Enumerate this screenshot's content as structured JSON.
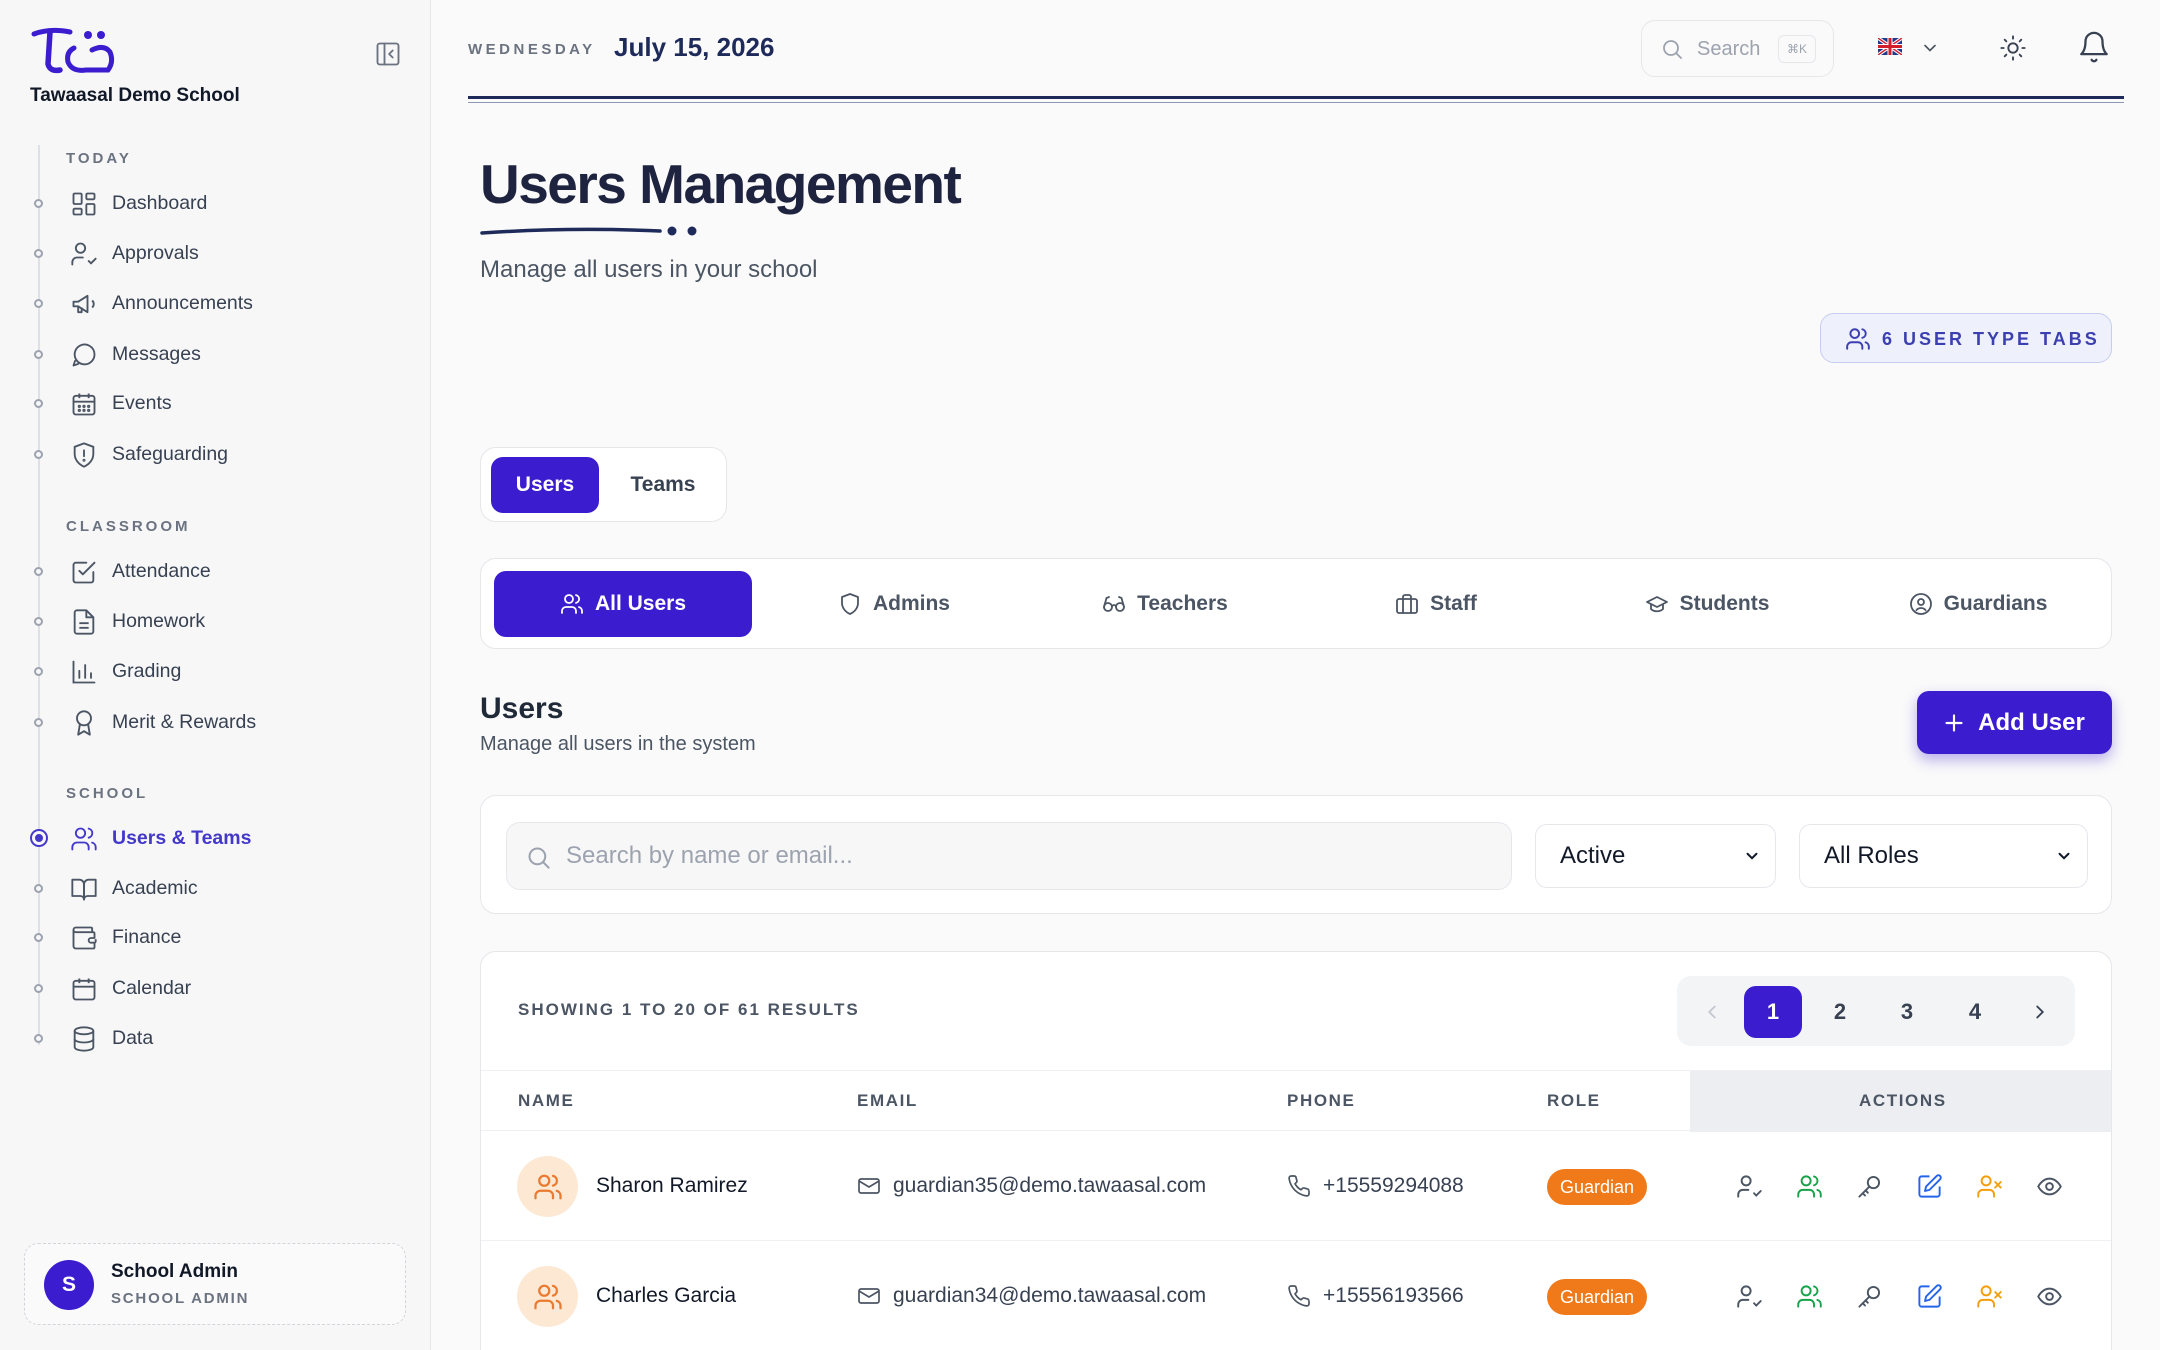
{
  "app": {
    "school_name": "Tawaasal Demo School"
  },
  "sidebar": {
    "sections": [
      {
        "label": "TODAY"
      },
      {
        "label": "CLASSROOM"
      },
      {
        "label": "SCHOOL"
      }
    ],
    "items": [
      {
        "label": "Dashboard",
        "icon": "dashboard-icon"
      },
      {
        "label": "Approvals",
        "icon": "user-check-icon"
      },
      {
        "label": "Announcements",
        "icon": "megaphone-icon"
      },
      {
        "label": "Messages",
        "icon": "message-icon"
      },
      {
        "label": "Events",
        "icon": "calendar-grid-icon"
      },
      {
        "label": "Safeguarding",
        "icon": "shield-alert-icon"
      },
      {
        "label": "Attendance",
        "icon": "checkbox-icon"
      },
      {
        "label": "Homework",
        "icon": "document-icon"
      },
      {
        "label": "Grading",
        "icon": "bar-chart-icon"
      },
      {
        "label": "Merit & Rewards",
        "icon": "award-icon"
      },
      {
        "label": "Users & Teams",
        "icon": "users-icon",
        "active": true
      },
      {
        "label": "Academic",
        "icon": "book-icon"
      },
      {
        "label": "Finance",
        "icon": "wallet-icon"
      },
      {
        "label": "Calendar",
        "icon": "calendar-icon"
      },
      {
        "label": "Data",
        "icon": "database-icon"
      }
    ],
    "user": {
      "initial": "S",
      "name": "School Admin",
      "role": "SCHOOL ADMIN"
    }
  },
  "header": {
    "weekday": "WEDNESDAY",
    "date": "July 15, 2026",
    "search_placeholder": "Search",
    "search_shortcut": "⌘K",
    "language_flag": "uk-flag-icon"
  },
  "page": {
    "title": "Users Management",
    "subtitle": "Manage all users in your school",
    "type_badge": "6 USER TYPE TABS"
  },
  "toggle": {
    "users": "Users",
    "teams": "Teams",
    "selected": "Users"
  },
  "type_tabs": [
    {
      "label": "All Users",
      "icon": "users-icon",
      "active": true
    },
    {
      "label": "Admins",
      "icon": "shield-icon"
    },
    {
      "label": "Teachers",
      "icon": "glasses-icon"
    },
    {
      "label": "Staff",
      "icon": "briefcase-icon"
    },
    {
      "label": "Students",
      "icon": "graduation-cap-icon"
    },
    {
      "label": "Guardians",
      "icon": "user-circle-icon"
    }
  ],
  "users_section": {
    "title": "Users",
    "subtitle": "Manage all users in the system",
    "add_button": "Add User"
  },
  "filters": {
    "search_placeholder": "Search by name or email...",
    "status_value": "Active",
    "role_value": "All Roles"
  },
  "table": {
    "showing": "SHOWING 1 TO 20 OF 61 RESULTS",
    "pages": [
      "1",
      "2",
      "3",
      "4"
    ],
    "current_page": "1",
    "columns": [
      "NAME",
      "EMAIL",
      "PHONE",
      "ROLE",
      "ACTIONS"
    ],
    "rows": [
      {
        "name": "Sharon Ramirez",
        "email": "guardian35@demo.tawaasal.com",
        "phone": "+15559294088",
        "role": "Guardian"
      },
      {
        "name": "Charles Garcia",
        "email": "guardian34@demo.tawaasal.com",
        "phone": "+15556193566",
        "role": "Guardian"
      }
    ]
  },
  "colors": {
    "primary": "#3b1ccf",
    "navy": "#1e2a5a",
    "guardian_badge": "#f07a1a",
    "avatar_bg": "#fde8d4"
  }
}
